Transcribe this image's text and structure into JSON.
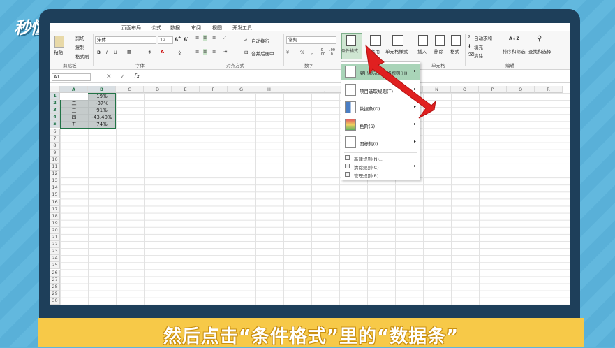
{
  "watermark": {
    "brand": "秒懂视频"
  },
  "caption": "然后点击“条件格式”里的“数据条”",
  "ribbon_tabs": [
    "页面布局",
    "公式",
    "数据",
    "审阅",
    "视图",
    "开发工具"
  ],
  "clipboard": {
    "paste": "粘贴",
    "cut": "剪切",
    "copy": "复制",
    "format_painter": "格式刷",
    "label": "剪贴板"
  },
  "font": {
    "name": "宋体",
    "size": "12",
    "label": "字体"
  },
  "alignment": {
    "wrap": "自动换行",
    "merge": "合并后居中",
    "label": "对齐方式"
  },
  "number": {
    "format": "常规",
    "label": "数字"
  },
  "styles": {
    "conditional": "条件格式",
    "table": "套用",
    "cell_styles": "单元格样式"
  },
  "cells_group": {
    "insert": "插入",
    "delete": "删除",
    "format": "格式",
    "label": "单元格"
  },
  "editing": {
    "autosum": "自动求和",
    "fill": "填充",
    "clear": "清除",
    "sort": "排序和筛选",
    "find": "查找和选择",
    "label": "编辑"
  },
  "formula_bar": {
    "name_box": "A1",
    "value": "一"
  },
  "columns": [
    "A",
    "B",
    "C",
    "D",
    "E",
    "F",
    "G",
    "H",
    "I",
    "J",
    "K",
    "L",
    "M",
    "N",
    "O",
    "P",
    "Q",
    "R"
  ],
  "rows": [
    "1",
    "2",
    "3",
    "4",
    "5",
    "6",
    "7",
    "8",
    "9",
    "10",
    "11",
    "12",
    "13",
    "14",
    "15",
    "16",
    "17",
    "18",
    "19",
    "20",
    "21",
    "22",
    "23",
    "24",
    "25",
    "26",
    "27",
    "28",
    "29",
    "30"
  ],
  "table": [
    {
      "a": "一",
      "b": "19%"
    },
    {
      "a": "二",
      "b": "-37%"
    },
    {
      "a": "三",
      "b": "91%"
    },
    {
      "a": "四",
      "b": "-43.40%"
    },
    {
      "a": "五",
      "b": "74%"
    }
  ],
  "cf_menu": {
    "items": [
      {
        "label": "突出显示单元格规则(H)",
        "submenu": true
      },
      {
        "label": "项目选取规则(T)",
        "submenu": true
      },
      {
        "label": "数据条(D)",
        "submenu": true
      },
      {
        "label": "色阶(S)",
        "submenu": true
      },
      {
        "label": "图标集(I)",
        "submenu": true
      }
    ],
    "small": [
      {
        "label": "新建规则(N)..."
      },
      {
        "label": "清除规则(C)",
        "submenu": true
      },
      {
        "label": "管理规则(R)..."
      }
    ]
  },
  "colors": {
    "highlight": "#a9d4b8",
    "selection": "#217346",
    "arrow": "#e02020",
    "caption_bg": "#f7c948"
  }
}
